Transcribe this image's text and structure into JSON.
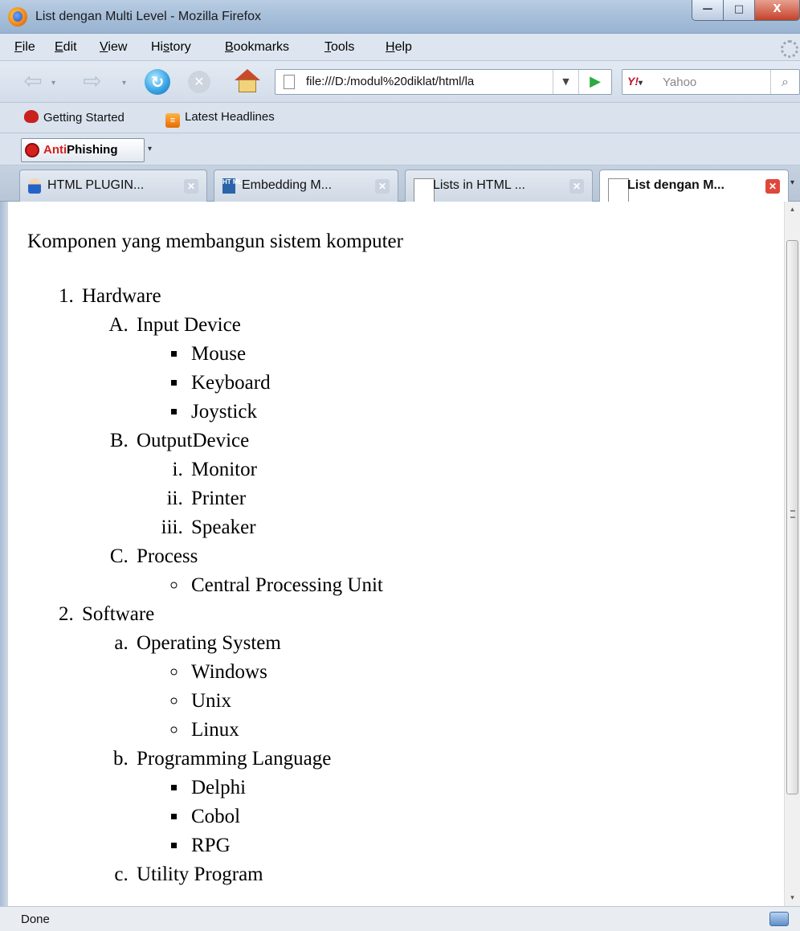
{
  "window": {
    "title": "List dengan Multi Level - Mozilla Firefox",
    "minimize_glyph": "—",
    "maximize_glyph": "□",
    "close_glyph": "X"
  },
  "menu": {
    "items": [
      {
        "accel": "F",
        "rest": "ile"
      },
      {
        "accel": "E",
        "rest": "dit"
      },
      {
        "accel": "V",
        "rest": "iew"
      },
      {
        "pre": "Hi",
        "accel": "s",
        "rest": "tory"
      },
      {
        "accel": "B",
        "rest": "ookmarks"
      },
      {
        "accel": "T",
        "rest": "ools"
      },
      {
        "accel": "H",
        "rest": "elp"
      }
    ]
  },
  "navigation": {
    "back_glyph": "⇦",
    "forward_glyph": "⇨",
    "reload_glyph": "↻",
    "stop_glyph": "✕",
    "url": "file:///D:/modul%20diklat/html/la",
    "url_dropdown_glyph": "▼",
    "go_glyph": "▶",
    "search_engine_logo": "Y!",
    "search_engine_drop": "▾",
    "search_placeholder": "Yahoo",
    "search_button_glyph": "⌕"
  },
  "bookmarks": {
    "items": [
      "Getting Started",
      "Latest Headlines"
    ],
    "rss_glyph": "≡"
  },
  "antiphishing": {
    "anti": "Anti",
    "phishing": "Phishing",
    "drop_glyph": "▾"
  },
  "tabs": [
    {
      "label": "HTML PLUGIN...",
      "icon": "user-icon",
      "active": false
    },
    {
      "label": "Embedding M...",
      "icon": "html-icon",
      "active": false
    },
    {
      "label": "Lists in HTML ...",
      "icon": "page-icon",
      "active": false
    },
    {
      "label": "List dengan M...",
      "icon": "page-icon",
      "active": true
    }
  ],
  "tab_close_glyph": "✕",
  "tab_overflow_glyph": "▾",
  "html_icon_text": "HT ML",
  "page": {
    "heading": "Komponen yang membangun sistem komputer",
    "list": [
      {
        "label": "Hardware",
        "sub_type": "upper-alpha",
        "children": [
          {
            "label": "Input Device",
            "sub_type": "square",
            "items": [
              "Mouse",
              "Keyboard",
              "Joystick"
            ]
          },
          {
            "label": "OutputDevice",
            "sub_type": "lower-roman",
            "items": [
              "Monitor",
              "Printer",
              "Speaker"
            ]
          },
          {
            "label": "Process",
            "sub_type": "circle",
            "items": [
              "Central Processing Unit"
            ]
          }
        ]
      },
      {
        "label": "Software",
        "sub_type": "lower-alpha",
        "children": [
          {
            "label": "Operating System",
            "sub_type": "circle",
            "items": [
              "Windows",
              "Unix",
              "Linux"
            ]
          },
          {
            "label": "Programming Language",
            "sub_type": "square",
            "items": [
              "Delphi",
              "Cobol",
              "RPG"
            ]
          },
          {
            "label": "Utility Program",
            "sub_type": "square",
            "items": []
          }
        ]
      }
    ]
  },
  "scroll": {
    "up_glyph": "▴",
    "down_glyph": "▾"
  },
  "status": {
    "text": "Done"
  },
  "colors": {
    "titlebar": "#a8c0da",
    "close_button": "#c4422b",
    "link_go": "#2eaa3c",
    "antiphishing_red": "#d6201c"
  }
}
